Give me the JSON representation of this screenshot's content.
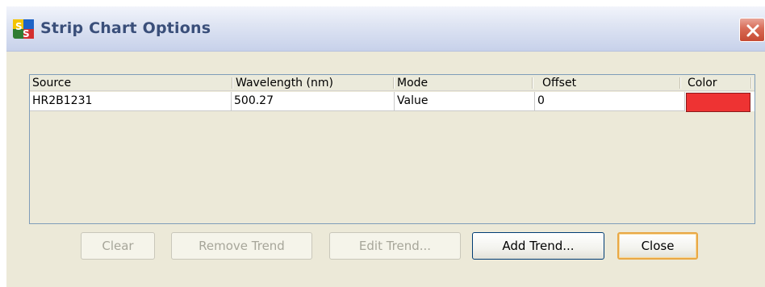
{
  "window": {
    "title": "Strip Chart Options",
    "icon": "ss-app-icon",
    "close_icon": "close-icon"
  },
  "table": {
    "columns": [
      "Source",
      "Wavelength (nm)",
      "Mode",
      "Offset",
      "Color"
    ],
    "rows": [
      {
        "source": "HR2B1231",
        "wavelength": "500.27",
        "mode": "Value",
        "offset": "0",
        "color": "#ee3333"
      }
    ]
  },
  "buttons": {
    "clear": "Clear",
    "remove_trend": "Remove Trend",
    "edit_trend": "Edit Trend...",
    "add_trend": "Add Trend...",
    "close": "Close"
  },
  "colors": {
    "title_text": "#3a4f7a",
    "close_button": "#d86a55",
    "dialog_bg": "#ece9d8",
    "focus_ring": "#e9a845"
  }
}
